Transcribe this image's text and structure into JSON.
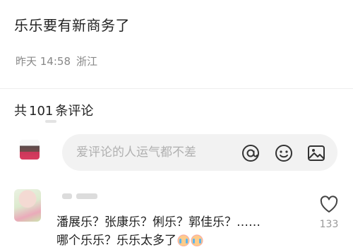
{
  "post": {
    "text": "乐乐要有新商务了",
    "time": "昨天 14:58",
    "location": "浙江"
  },
  "comments_header": {
    "prefix": "共",
    "count": "101",
    "suffix": "条评论"
  },
  "input": {
    "placeholder": "爱评论的人运气都不差",
    "icons": [
      "at-icon",
      "emoji-icon",
      "image-icon"
    ]
  },
  "comment": {
    "line1": "潘展乐？张康乐？俐乐？郭佳乐？……",
    "line2": "哪个乐乐？乐乐太多了",
    "emojis": [
      "crying-emoji",
      "crying-emoji"
    ],
    "like_count": "133"
  },
  "colors": {
    "text": "#222222",
    "muted": "#888888",
    "input_bg": "#f2f2f2",
    "placeholder": "#b0b0b0"
  }
}
